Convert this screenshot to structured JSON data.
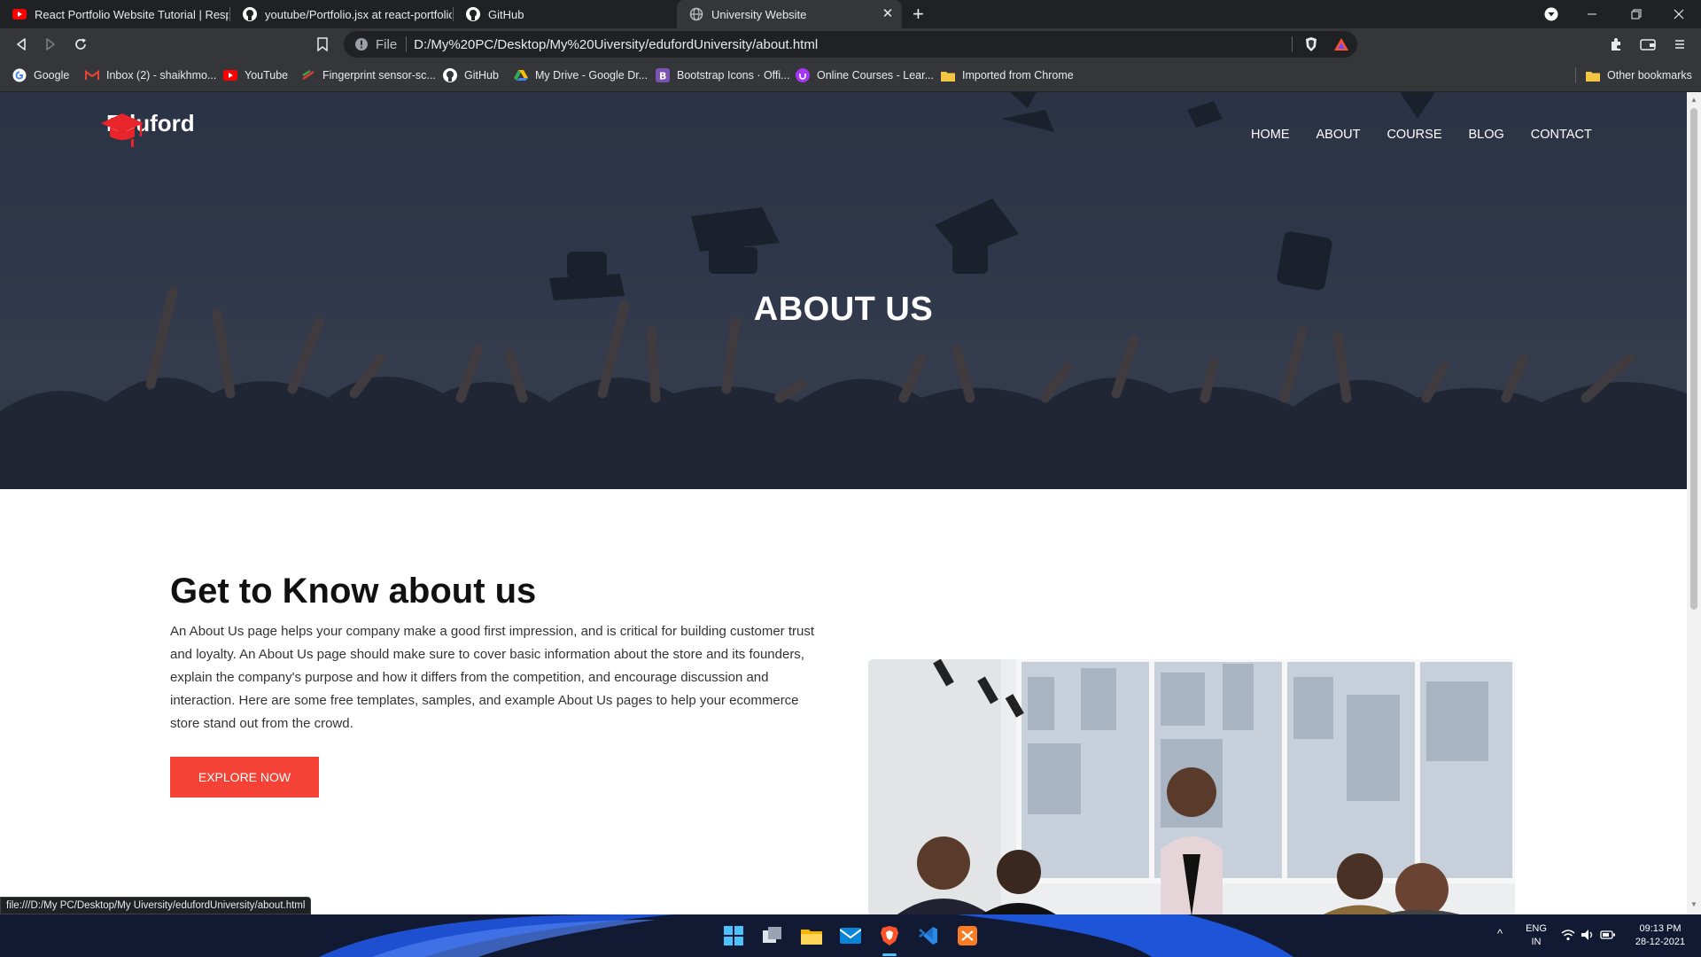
{
  "browser": {
    "tabs": [
      {
        "title": "React Portfolio Website Tutorial | Respons",
        "icon": "youtube-icon"
      },
      {
        "title": "youtube/Portfolio.jsx at react-portfolio · s",
        "icon": "github-icon"
      },
      {
        "title": "GitHub",
        "icon": "github-icon"
      },
      {
        "title": "University Website",
        "icon": "globe-icon",
        "active": true
      }
    ],
    "new_tab": "+",
    "address_scheme": "File",
    "address_url": "D:/My%20PC/Desktop/My%20Uiversity/edufordUniversity/about.html",
    "bookmarks": [
      {
        "label": "Google",
        "icon": "google-icon"
      },
      {
        "label": "Inbox (2) - shaikhmo...",
        "icon": "gmail-icon"
      },
      {
        "label": "YouTube",
        "icon": "youtube-icon"
      },
      {
        "label": "Fingerprint sensor-sc...",
        "icon": "fingerprint-icon"
      },
      {
        "label": "GitHub",
        "icon": "github-icon"
      },
      {
        "label": "My Drive - Google Dr...",
        "icon": "drive-icon"
      },
      {
        "label": "Bootstrap Icons · Offi...",
        "icon": "bootstrap-icon"
      },
      {
        "label": "Online Courses - Lear...",
        "icon": "udemy-icon"
      },
      {
        "label": "Imported from Chrome",
        "icon": "folder-icon"
      }
    ],
    "other_bookmarks": "Other bookmarks",
    "status_url": "file:///D:/My PC/Desktop/My Uiversity/edufordUniversity/about.html"
  },
  "site": {
    "brand": "Eduford",
    "nav": [
      "HOME",
      "ABOUT",
      "COURSE",
      "BLOG",
      "CONTACT"
    ],
    "hero_title": "ABOUT US",
    "about": {
      "heading": "Get to Know about us",
      "body": "An About Us page helps your company make a good first impression, and is critical for building customer trust and loyalty. An About Us page should make sure to cover basic information about the store and its founders, explain the company's purpose and how it differs from the competition, and encourage discussion and interaction. Here are some free templates, samples, and example About Us pages to help your ecommerce store stand out from the crowd.",
      "button": "EXPLORE NOW"
    },
    "colors": {
      "accent": "#f44336",
      "hero_overlay": "#2b3346"
    }
  },
  "taskbar": {
    "apps": [
      "windows-start-icon",
      "task-view-icon",
      "file-explorer-icon",
      "mail-icon",
      "brave-icon",
      "vscode-icon",
      "xampp-icon"
    ],
    "language": "ENG",
    "region": "IN",
    "time": "09:13 PM",
    "date": "28-12-2021"
  }
}
